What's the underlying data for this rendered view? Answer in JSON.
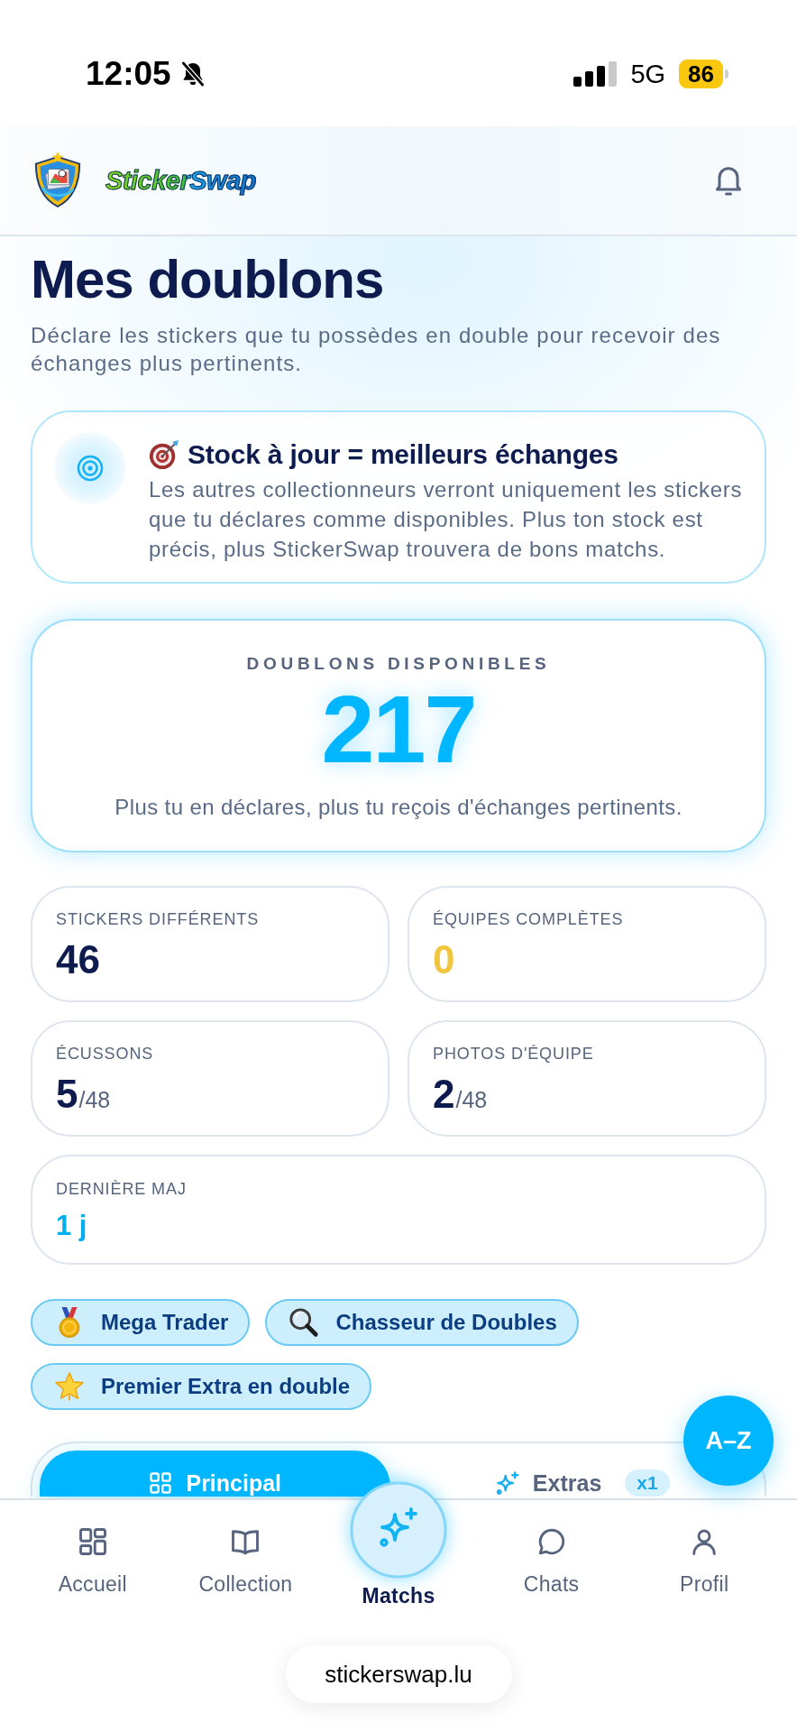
{
  "status_bar": {
    "time": "12:05",
    "network": "5G",
    "battery": "86"
  },
  "header": {
    "brand": "StickerSwap"
  },
  "page": {
    "title": "Mes doublons",
    "subtitle": "Déclare les stickers que tu possèdes en double pour recevoir des échanges plus pertinents."
  },
  "tip": {
    "title": "Stock à jour = meilleurs échanges",
    "text": "Les autres collectionneurs verront uniquement les stickers que tu déclares comme disponibles. Plus ton stock est précis, plus StickerSwap trouvera de bons matchs."
  },
  "summary": {
    "label": "DOUBLONS DISPONIBLES",
    "value": "217",
    "note": "Plus tu en déclares, plus tu reçois d'échanges pertinents."
  },
  "stats": [
    {
      "kind": "count",
      "label": "STICKERS DIFFÉRENTS",
      "value": "46",
      "color": "#0d1b4f"
    },
    {
      "kind": "count",
      "label": "ÉQUIPES COMPLÈTES",
      "value": "0",
      "color": "#f0c63e"
    },
    {
      "kind": "fraction",
      "label": "ÉCUSSONS",
      "value": "5",
      "total": "/48",
      "color": "#0d1b4f"
    },
    {
      "kind": "fraction",
      "label": "PHOTOS D'ÉQUIPE",
      "value": "2",
      "total": "/48",
      "color": "#0d1b4f"
    },
    {
      "kind": "age",
      "label": "DERNIÈRE MAJ",
      "value": "1 j",
      "color": "#00aef0"
    }
  ],
  "badges": [
    {
      "label": "Mega Trader"
    },
    {
      "label": "Chasseur de Doubles"
    },
    {
      "label": "Premier Extra en double"
    }
  ],
  "tabs": [
    {
      "label": "Principal",
      "selected": true
    },
    {
      "label": "Extras",
      "selected": false,
      "count": "x1"
    }
  ],
  "sort_button": {
    "label": "A–Z"
  },
  "bottom_nav": [
    {
      "label": "Accueil",
      "selected": false
    },
    {
      "label": "Collection",
      "selected": false
    },
    {
      "label": "Matchs",
      "selected": true
    },
    {
      "label": "Chats",
      "selected": false
    },
    {
      "label": "Profil",
      "selected": false
    }
  ],
  "browser": {
    "url": "stickerswap.lu"
  }
}
